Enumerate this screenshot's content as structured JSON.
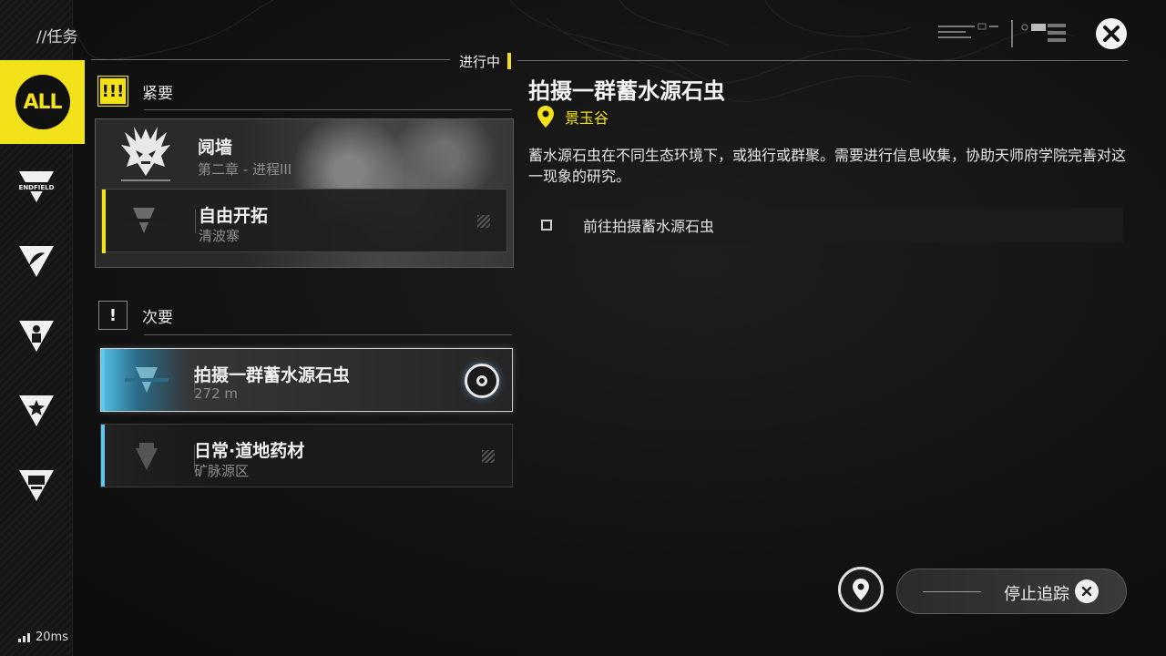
{
  "header": {
    "title": "//任务"
  },
  "sidebar": {
    "items": [
      {
        "label": "ALL",
        "icon": "all-badge-icon",
        "active": true
      },
      {
        "label": "ENDFIELD",
        "icon": "endfield-triangle-icon"
      },
      {
        "label": "",
        "icon": "wing-triangle-icon"
      },
      {
        "label": "",
        "icon": "person-triangle-icon"
      },
      {
        "label": "",
        "icon": "star-triangle-icon"
      },
      {
        "label": "",
        "icon": "gear-triangle-icon"
      }
    ]
  },
  "status": {
    "in_progress": "进行中"
  },
  "urgent": {
    "heading": "紧要",
    "chief": {
      "title": "阋墙",
      "subtitle": "第二章 - 进程III"
    },
    "sub": {
      "title": "自由开拓",
      "subtitle": "清波寨"
    }
  },
  "minor": {
    "heading": "次要",
    "items": [
      {
        "title": "拍摄一群蓄水源石虫",
        "subtitle": "272 m",
        "selected": true
      },
      {
        "title": "日常·道地药材",
        "subtitle": "矿脉源区",
        "selected": false
      }
    ]
  },
  "detail": {
    "title": "拍摄一群蓄水源石虫",
    "location": "景玉谷",
    "description": "蓄水源石虫在不同生态环境下，或独行或群聚。需要进行信息收集，协助天师府学院完善对这一现象的研究。",
    "objective": "前往拍摄蓄水源石虫"
  },
  "footer": {
    "ping": "20ms",
    "stop_tracking": "停止追踪"
  },
  "colors": {
    "accent_yellow": "#f3e21a",
    "accent_blue": "#5bc8f0"
  }
}
